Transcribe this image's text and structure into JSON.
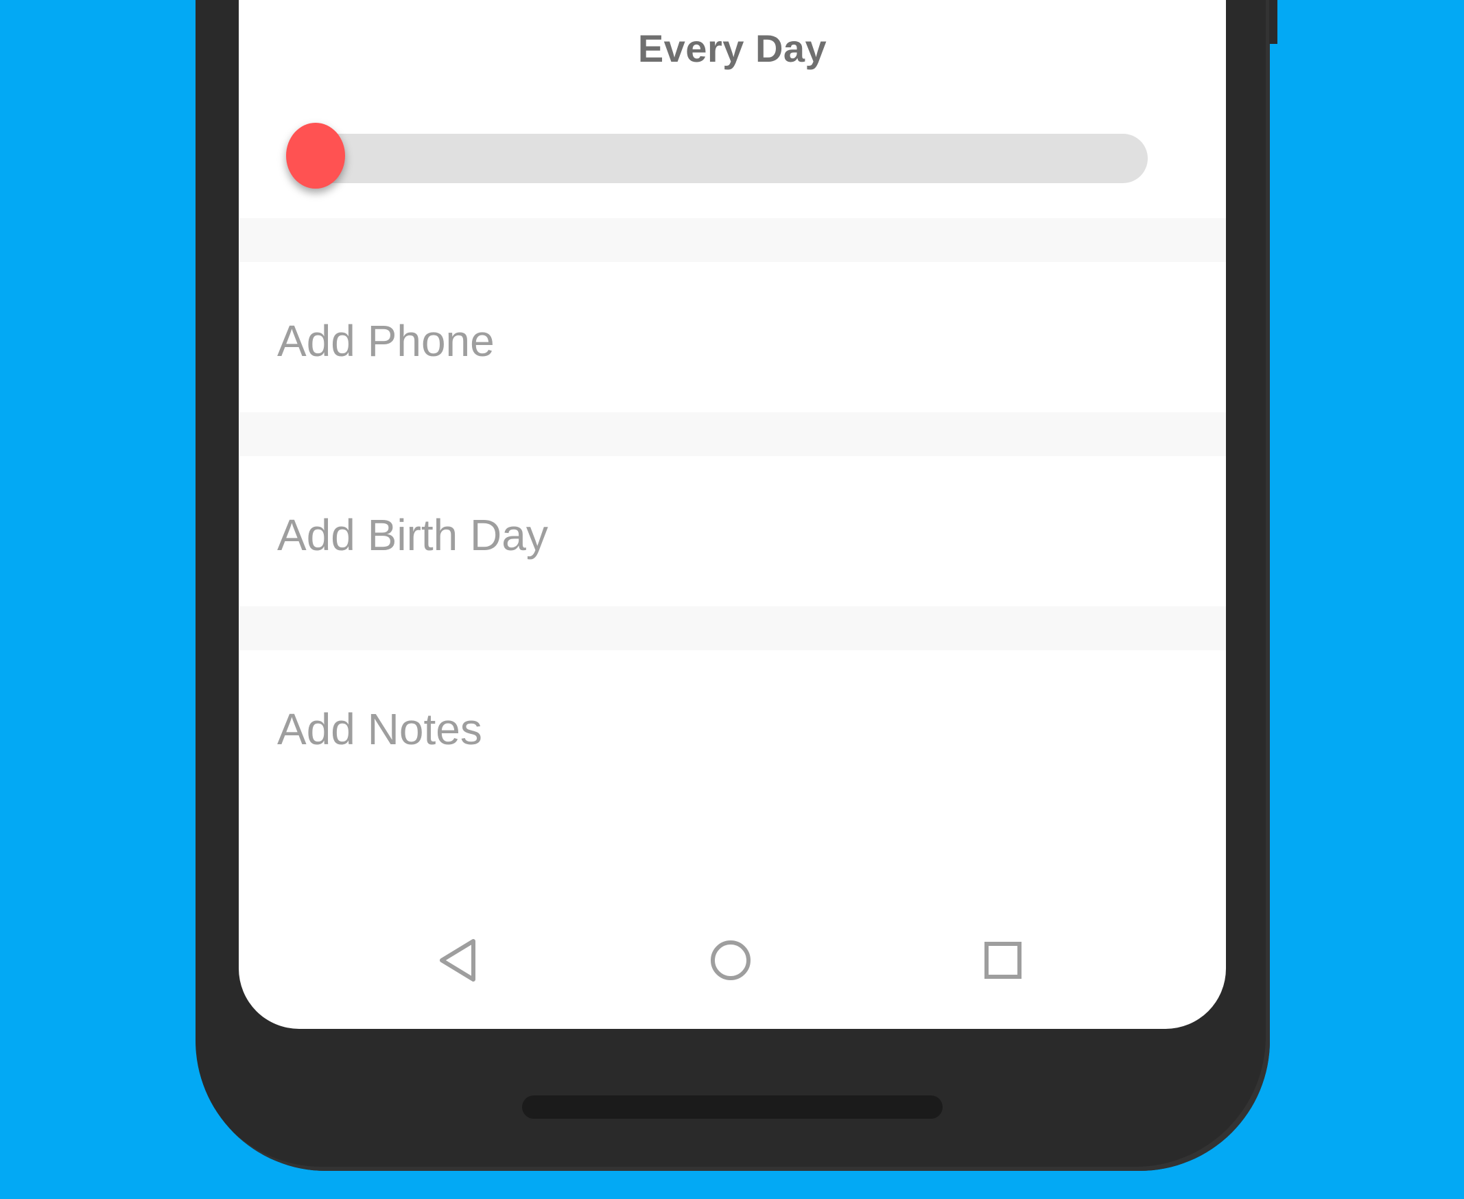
{
  "frequency": {
    "title": "Every Day",
    "slider_value": 0
  },
  "fields": {
    "phone_placeholder": "Add Phone",
    "birthday_placeholder": "Add Birth Day",
    "notes_placeholder": "Add Notes"
  },
  "navbar": {
    "back_icon": "back-triangle",
    "home_icon": "home-circle",
    "recents_icon": "recents-square"
  },
  "colors": {
    "background": "#03A9F4",
    "slider_thumb": "#FF5252",
    "slider_track": "#E0E0E0",
    "placeholder_text": "#9E9E9E"
  }
}
